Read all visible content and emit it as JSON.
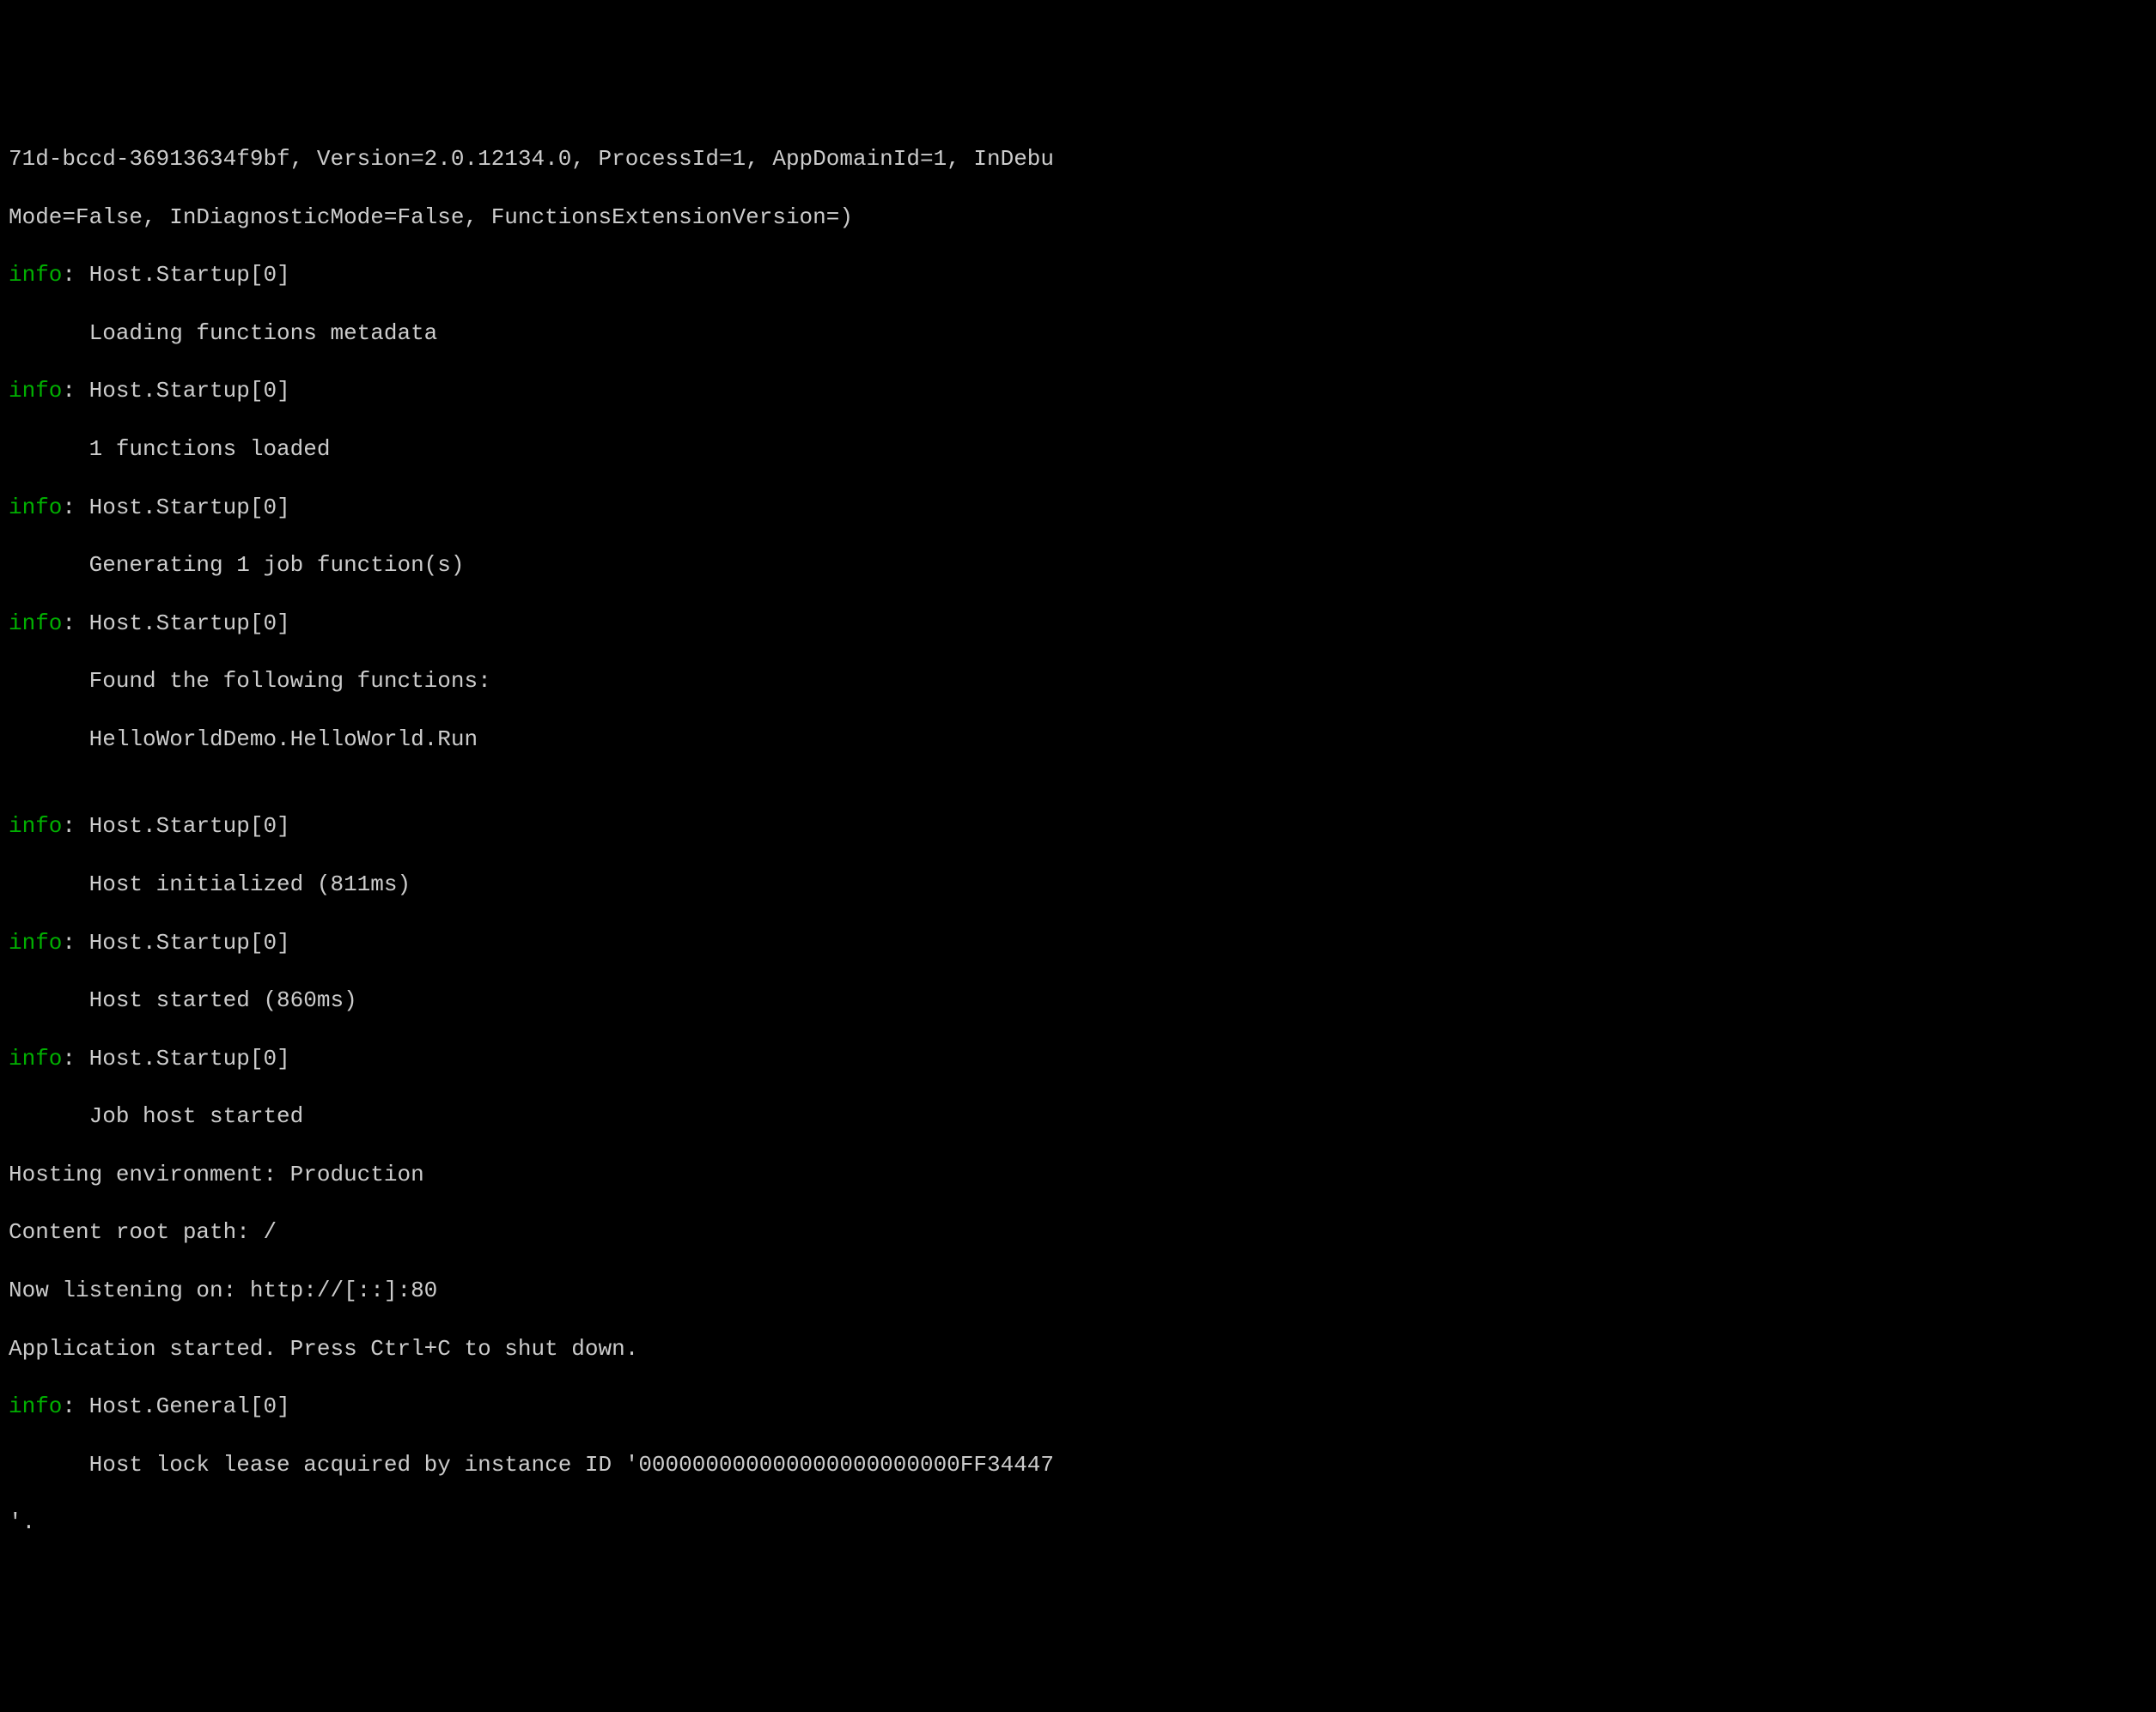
{
  "lines": {
    "l0": "71d-bccd-36913634f9bf, Version=2.0.12134.0, ProcessId=1, AppDomainId=1, InDebu",
    "l1": "Mode=False, InDiagnosticMode=False, FunctionsExtensionVersion=)",
    "l2_level": "info",
    "l2_src": ": Host.Startup[0]",
    "l3": "      Loading functions metadata",
    "l4_level": "info",
    "l4_src": ": Host.Startup[0]",
    "l5": "      1 functions loaded",
    "l6_level": "info",
    "l6_src": ": Host.Startup[0]",
    "l7": "      Generating 1 job function(s)",
    "l8_level": "info",
    "l8_src": ": Host.Startup[0]",
    "l9": "      Found the following functions:",
    "l10": "      HelloWorldDemo.HelloWorld.Run",
    "l11": "",
    "l12_level": "info",
    "l12_src": ": Host.Startup[0]",
    "l13": "      Host initialized (811ms)",
    "l14_level": "info",
    "l14_src": ": Host.Startup[0]",
    "l15": "      Host started (860ms)",
    "l16_level": "info",
    "l16_src": ": Host.Startup[0]",
    "l17": "      Job host started",
    "l18": "Hosting environment: Production",
    "l19": "Content root path: /",
    "l20": "Now listening on: http://[::]:80",
    "l21": "Application started. Press Ctrl+C to shut down.",
    "l22_level": "info",
    "l22_src": ": Host.General[0]",
    "l23": "      Host lock lease acquired by instance ID '000000000000000000000000FF34447",
    "l24": "'."
  }
}
